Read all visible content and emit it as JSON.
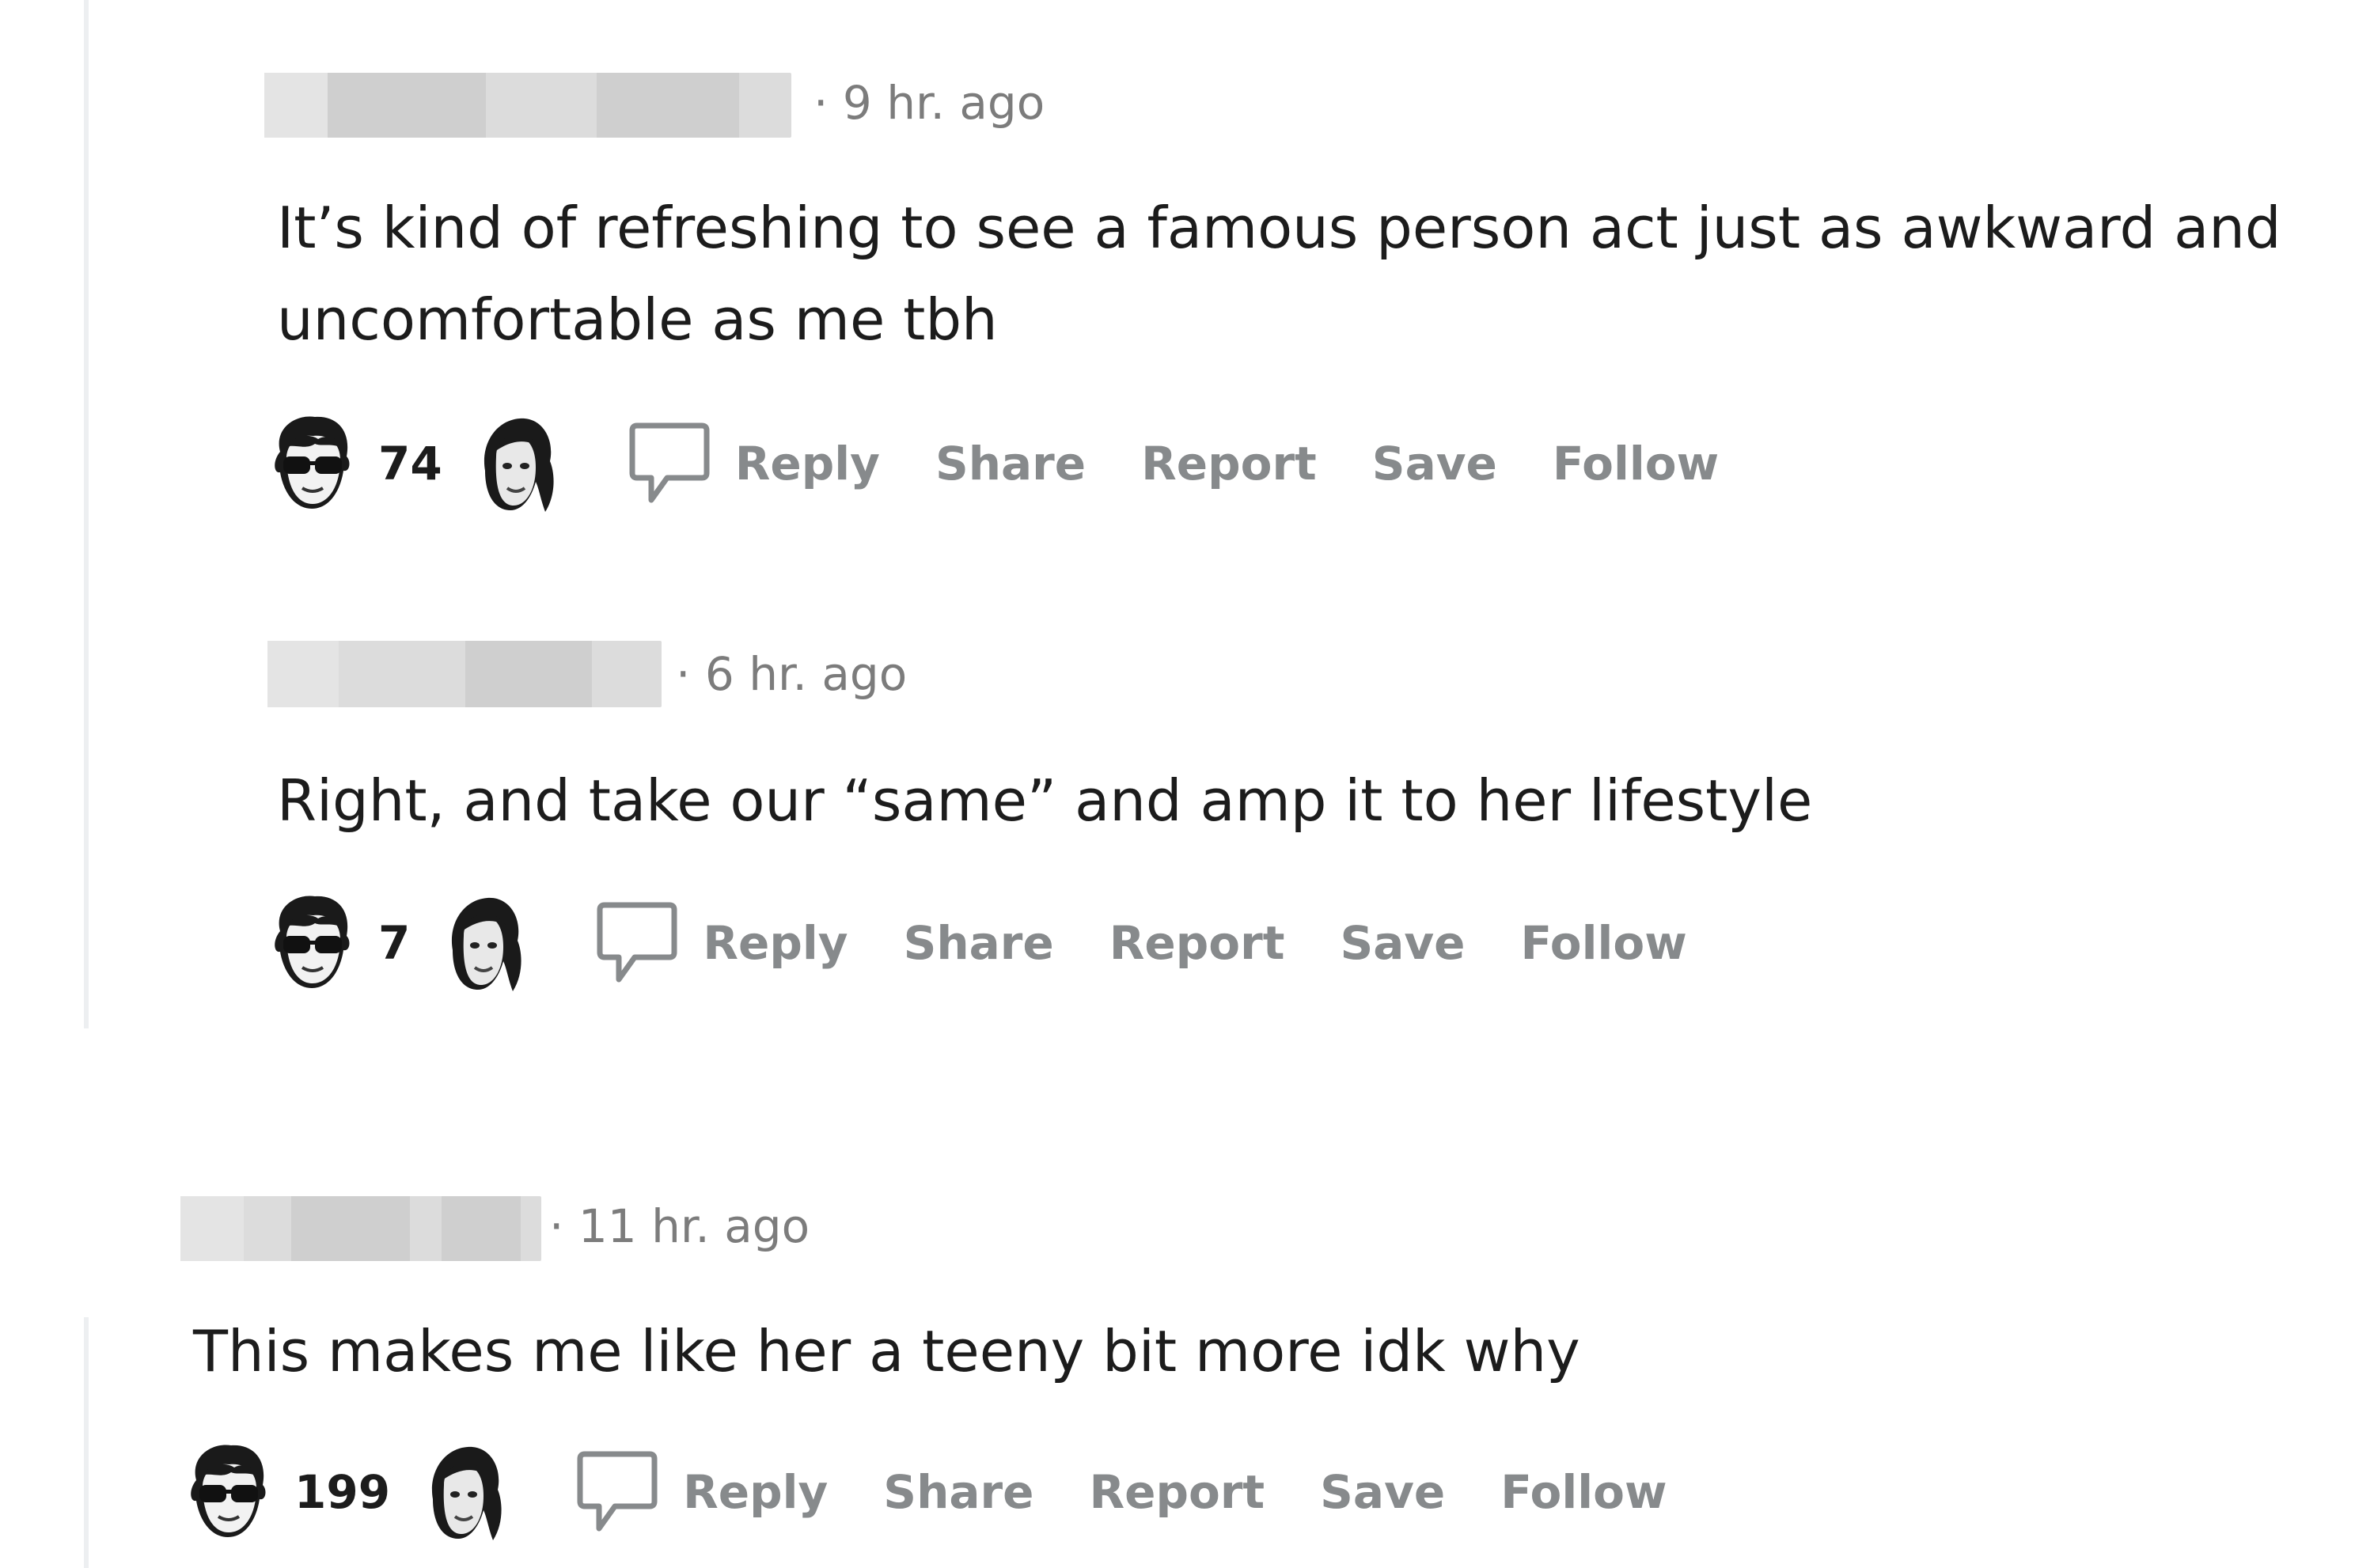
{
  "comments": [
    {
      "timestamp": "· 9 hr. ago",
      "body_lines": [
        "It’s kind of refreshing to see a famous person act just as awkward and",
        "uncomfortable as me tbh"
      ],
      "votes": "74",
      "actions": {
        "reply": "Reply",
        "share": "Share",
        "report": "Report",
        "save": "Save",
        "follow": "Follow"
      }
    },
    {
      "timestamp": "· 6 hr. ago",
      "body_lines": [
        "Right, and take our “same” and amp it to her lifestyle"
      ],
      "votes": "7",
      "actions": {
        "reply": "Reply",
        "share": "Share",
        "report": "Report",
        "save": "Save",
        "follow": "Follow"
      }
    },
    {
      "timestamp": "· 11 hr. ago",
      "body_lines": [
        "This makes me like her a teeny bit more idk why"
      ],
      "votes": "199",
      "actions": {
        "reply": "Reply",
        "share": "Share",
        "report": "Report",
        "save": "Save",
        "follow": "Follow"
      }
    }
  ],
  "icons": {
    "upvote": "glasses-face-icon",
    "downvote": "ponytail-face-icon",
    "reply": "speech-bubble-icon"
  },
  "colors": {
    "action_text": "#878a8c",
    "timestamp": "#7c7c7c",
    "thread_line": "#edeff1"
  }
}
